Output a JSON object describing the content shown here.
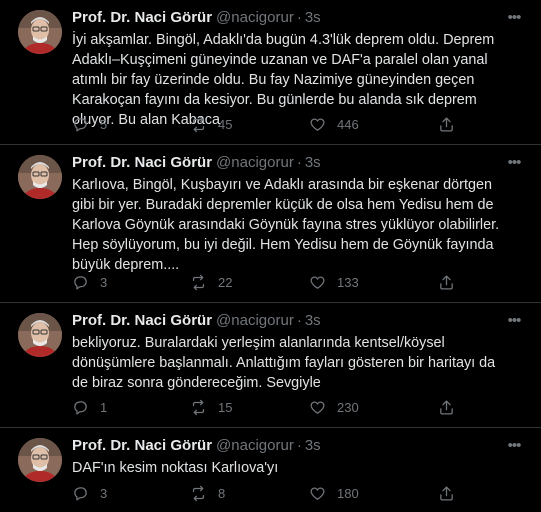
{
  "colors": {
    "background": "#000000",
    "text": "#e1e3e5",
    "muted": "#71767b",
    "divider": "#2f3336"
  },
  "tweets": [
    {
      "name": "Prof. Dr. Naci Görür",
      "handle": "@nacigorur",
      "dot": "·",
      "time": "3s",
      "text": "İyi akşamlar. Bingöl, Adaklı'da bugün 4.3'lük deprem oldu. Deprem Adaklı–Kuşçimeni güneyinde uzanan ve DAF'a paralel olan yanal atımlı bir fay üzerinde oldu. Bu fay Nazimiye güneyinden geçen Karakoçan fayını da kesiyor. Bu günlerde bu alanda sık deprem oluyor. Bu alan Kabaca",
      "replies": "5",
      "retweets": "45",
      "likes": "446"
    },
    {
      "name": "Prof. Dr. Naci Görür",
      "handle": "@nacigorur",
      "dot": "·",
      "time": "3s",
      "text": "Karlıova, Bingöl, Kuşbayırı ve Adaklı arasında bir eşkenar dörtgen gibi bir yer. Buradaki depremler küçük de olsa hem Yedisu hem de Karlova Göynük arasındaki Göynük fayına stres yüklüyor olabilirler. Hep söylüyorum, bu iyi değil. Hem Yedisu hem de Göynük fayında büyük deprem....",
      "replies": "3",
      "retweets": "22",
      "likes": "133"
    },
    {
      "name": "Prof. Dr. Naci Görür",
      "handle": "@nacigorur",
      "dot": "·",
      "time": "3s",
      "text": "bekliyoruz. Buralardaki yerleşim alanlarında kentsel/köysel dönüşümlere başlanmalı. Anlattığım fayları gösteren bir haritayı da de biraz sonra göndereceğim. Sevgiyle",
      "replies": "1",
      "retweets": "15",
      "likes": "230"
    },
    {
      "name": "Prof. Dr. Naci Görür",
      "handle": "@nacigorur",
      "dot": "·",
      "time": "3s",
      "text": "DAF'ın kesim noktası Karlıova'yı",
      "replies": "3",
      "retweets": "8",
      "likes": "180"
    }
  ]
}
